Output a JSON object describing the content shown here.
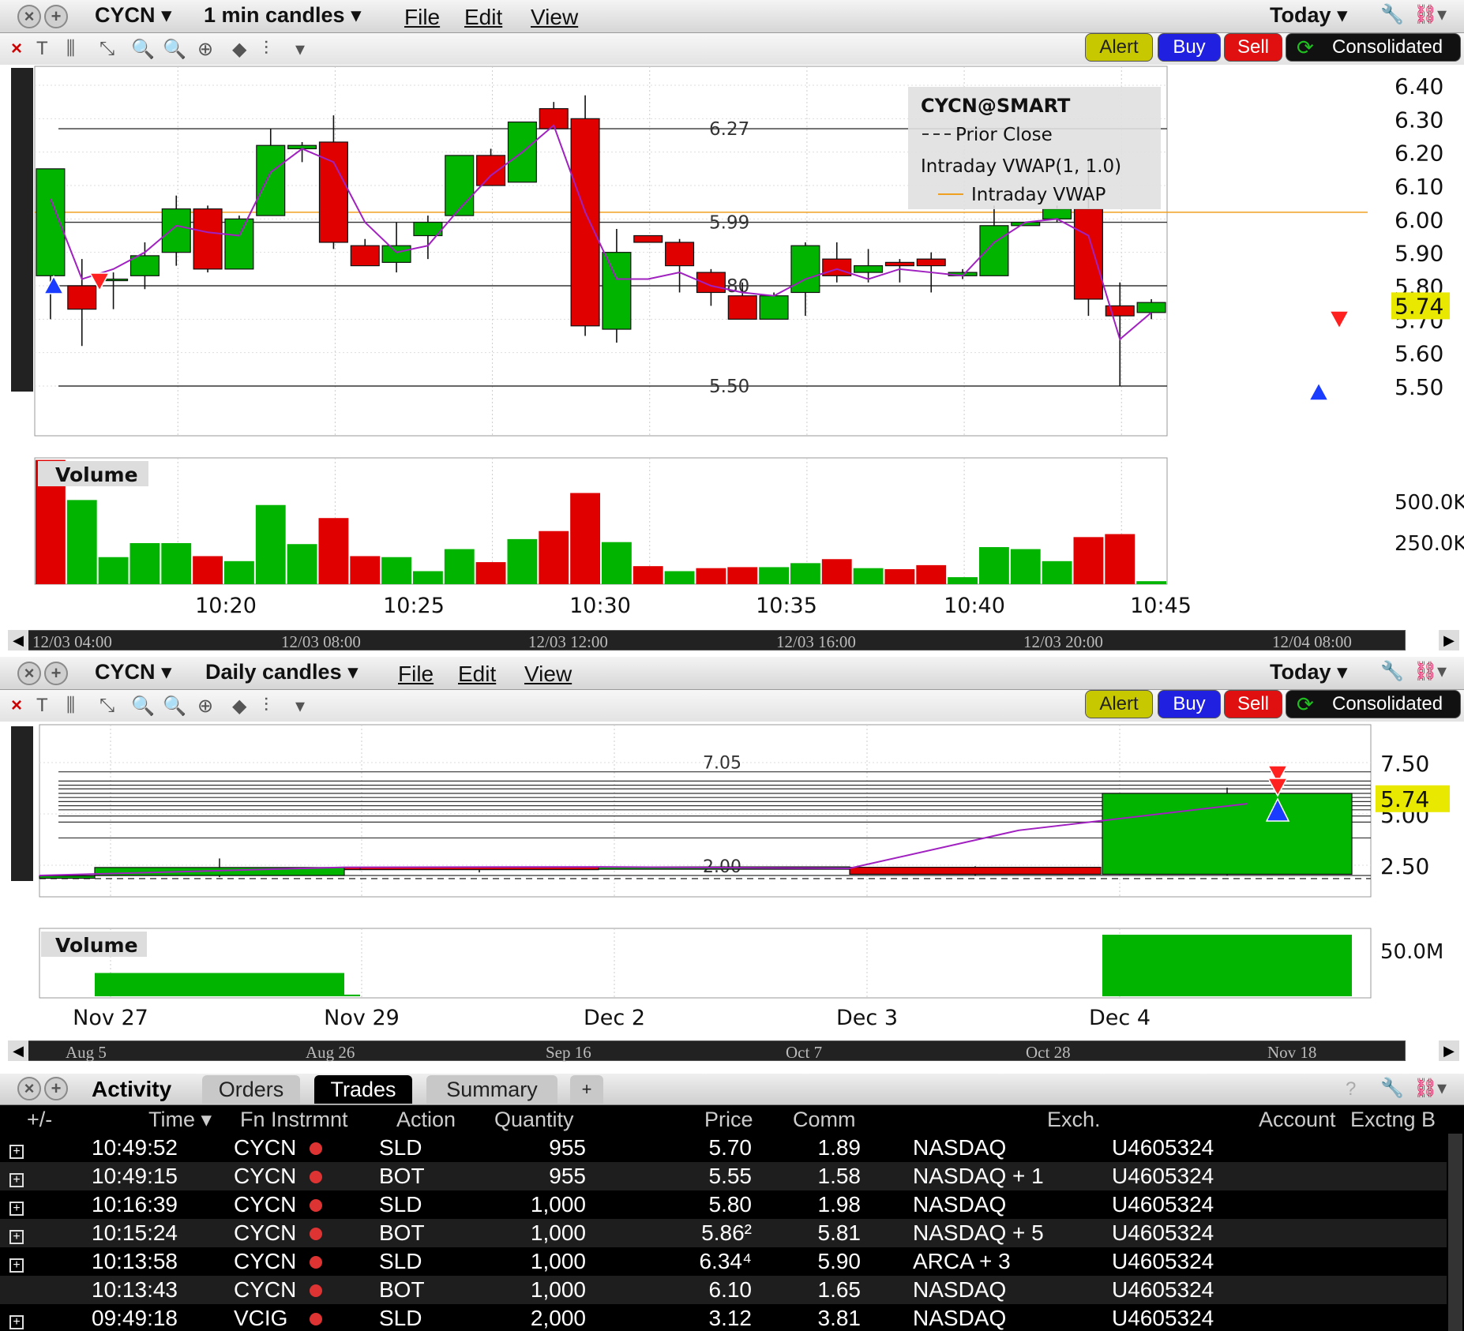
{
  "colors": {
    "up": "#00b400",
    "down": "#e00000",
    "vwap": "#a020c0",
    "prior_close": "#f0a020",
    "alert": "#c8c800",
    "buy": "#2020e0",
    "sell": "#e01010",
    "last_price_tag": "#e8e800"
  },
  "chart1": {
    "symbol": "CYCN",
    "timeframe": "1 min candles",
    "menu": [
      "File",
      "Edit",
      "View"
    ],
    "range": "Today",
    "buttons": {
      "alert": "Alert",
      "buy": "Buy",
      "sell": "Sell",
      "consolidated": "Consolidated"
    },
    "legend": {
      "title": "CYCN@SMART",
      "prior_close": "Prior Close",
      "vwap_study": "Intraday VWAP(1, 1.0)",
      "vwap": "Intraday VWAP"
    },
    "price_labels": [
      "6.27",
      "5.99",
      "5.80",
      "5.50"
    ],
    "last_price": "5.74",
    "volume_label": "Volume",
    "volume_ticks": [
      "500.0K",
      "250.0K"
    ],
    "x_ticks": [
      "10:20",
      "10:25",
      "10:30",
      "10:35",
      "10:40",
      "10:45"
    ],
    "nav_ticks": [
      "12/03 04:00",
      "12/03 08:00",
      "12/03 12:00",
      "12/03 16:00",
      "12/03 20:00",
      "12/04 08:00"
    ]
  },
  "chart2": {
    "symbol": "CYCN",
    "timeframe": "Daily candles",
    "menu": [
      "File",
      "Edit",
      "View"
    ],
    "range": "Today",
    "buttons": {
      "alert": "Alert",
      "buy": "Buy",
      "sell": "Sell",
      "consolidated": "Consolidated"
    },
    "price_labels": [
      "7.05",
      "2.00"
    ],
    "last_price": "5.74",
    "volume_label": "Volume",
    "volume_ticks": [
      "50.0M"
    ],
    "x_ticks": [
      "Nov 27",
      "Nov 29",
      "Dec 2",
      "Dec 3",
      "Dec 4"
    ],
    "nav_ticks": [
      "Aug 5",
      "Aug 26",
      "Sep 16",
      "Oct 7",
      "Oct 28",
      "Nov 18"
    ]
  },
  "chart_data": [
    {
      "type": "candlestick",
      "title": "CYCN 1 min candles",
      "ylim": [
        5.45,
        6.42
      ],
      "y_ticks": [
        "6.40",
        "6.30",
        "6.20",
        "6.10",
        "6.00",
        "5.90",
        "5.80",
        "5.70",
        "5.60",
        "5.50"
      ],
      "x_ticks": [
        "10:20",
        "10:25",
        "10:30",
        "10:35",
        "10:40",
        "10:45"
      ],
      "candles": [
        {
          "o": 5.83,
          "h": 6.15,
          "l": 5.7,
          "c": 6.15
        },
        {
          "o": 5.8,
          "h": 5.88,
          "l": 5.62,
          "c": 5.73
        },
        {
          "o": 5.82,
          "h": 5.84,
          "l": 5.73,
          "c": 5.82
        },
        {
          "o": 5.83,
          "h": 5.93,
          "l": 5.79,
          "c": 5.89
        },
        {
          "o": 5.9,
          "h": 6.07,
          "l": 5.86,
          "c": 6.03
        },
        {
          "o": 6.03,
          "h": 6.04,
          "l": 5.84,
          "c": 5.85
        },
        {
          "o": 5.85,
          "h": 6.01,
          "l": 5.85,
          "c": 6.0
        },
        {
          "o": 6.01,
          "h": 6.27,
          "l": 6.01,
          "c": 6.22
        },
        {
          "o": 6.21,
          "h": 6.23,
          "l": 6.17,
          "c": 6.22
        },
        {
          "o": 6.23,
          "h": 6.31,
          "l": 5.91,
          "c": 5.93
        },
        {
          "o": 5.92,
          "h": 5.94,
          "l": 5.86,
          "c": 5.86
        },
        {
          "o": 5.87,
          "h": 5.99,
          "l": 5.84,
          "c": 5.92
        },
        {
          "o": 5.95,
          "h": 6.01,
          "l": 5.88,
          "c": 5.99
        },
        {
          "o": 6.01,
          "h": 6.19,
          "l": 6.01,
          "c": 6.19
        },
        {
          "o": 6.19,
          "h": 6.21,
          "l": 6.1,
          "c": 6.1
        },
        {
          "o": 6.11,
          "h": 6.29,
          "l": 6.11,
          "c": 6.29
        },
        {
          "o": 6.33,
          "h": 6.35,
          "l": 6.28,
          "c": 6.27
        },
        {
          "o": 6.3,
          "h": 6.37,
          "l": 5.65,
          "c": 5.68
        },
        {
          "o": 5.67,
          "h": 5.97,
          "l": 5.63,
          "c": 5.9
        },
        {
          "o": 5.95,
          "h": 5.95,
          "l": 5.93,
          "c": 5.93
        },
        {
          "o": 5.93,
          "h": 5.94,
          "l": 5.78,
          "c": 5.86
        },
        {
          "o": 5.84,
          "h": 5.85,
          "l": 5.74,
          "c": 5.78
        },
        {
          "o": 5.77,
          "h": 5.81,
          "l": 5.7,
          "c": 5.7
        },
        {
          "o": 5.7,
          "h": 5.78,
          "l": 5.7,
          "c": 5.77
        },
        {
          "o": 5.78,
          "h": 5.93,
          "l": 5.71,
          "c": 5.92
        },
        {
          "o": 5.88,
          "h": 5.93,
          "l": 5.81,
          "c": 5.83
        },
        {
          "o": 5.84,
          "h": 5.91,
          "l": 5.81,
          "c": 5.86
        },
        {
          "o": 5.87,
          "h": 5.88,
          "l": 5.81,
          "c": 5.86
        },
        {
          "o": 5.88,
          "h": 5.9,
          "l": 5.78,
          "c": 5.86
        },
        {
          "o": 5.83,
          "h": 5.85,
          "l": 5.82,
          "c": 5.84
        },
        {
          "o": 5.83,
          "h": 6.04,
          "l": 5.83,
          "c": 5.98
        },
        {
          "o": 5.98,
          "h": 5.99,
          "l": 5.98,
          "c": 5.99
        },
        {
          "o": 6.0,
          "h": 6.04,
          "l": 5.99,
          "c": 6.03
        },
        {
          "o": 6.03,
          "h": 6.18,
          "l": 5.71,
          "c": 5.76
        },
        {
          "o": 5.74,
          "h": 5.81,
          "l": 5.5,
          "c": 5.71
        },
        {
          "o": 5.72,
          "h": 5.76,
          "l": 5.7,
          "c": 5.75
        }
      ],
      "vwap": [
        6.06,
        5.82,
        5.85,
        5.9,
        5.98,
        5.96,
        5.95,
        6.14,
        6.21,
        6.17,
        5.99,
        5.9,
        5.92,
        6.03,
        6.13,
        6.2,
        6.28,
        6.02,
        5.82,
        5.82,
        5.84,
        5.8,
        5.78,
        5.77,
        5.82,
        5.85,
        5.82,
        5.85,
        5.84,
        5.83,
        5.93,
        5.99,
        6.0,
        5.95,
        5.64,
        5.72
      ],
      "volume": [
        {
          "v": 620,
          "up": false
        },
        {
          "v": 420,
          "up": true
        },
        {
          "v": 135,
          "up": true
        },
        {
          "v": 205,
          "up": true
        },
        {
          "v": 205,
          "up": true
        },
        {
          "v": 140,
          "up": false
        },
        {
          "v": 115,
          "up": true
        },
        {
          "v": 395,
          "up": true
        },
        {
          "v": 200,
          "up": true
        },
        {
          "v": 330,
          "up": false
        },
        {
          "v": 140,
          "up": false
        },
        {
          "v": 135,
          "up": true
        },
        {
          "v": 65,
          "up": true
        },
        {
          "v": 175,
          "up": true
        },
        {
          "v": 110,
          "up": false
        },
        {
          "v": 225,
          "up": true
        },
        {
          "v": 265,
          "up": false
        },
        {
          "v": 455,
          "up": false
        },
        {
          "v": 210,
          "up": true
        },
        {
          "v": 90,
          "up": false
        },
        {
          "v": 65,
          "up": true
        },
        {
          "v": 80,
          "up": false
        },
        {
          "v": 85,
          "up": false
        },
        {
          "v": 85,
          "up": true
        },
        {
          "v": 105,
          "up": true
        },
        {
          "v": 125,
          "up": false
        },
        {
          "v": 80,
          "up": true
        },
        {
          "v": 75,
          "up": false
        },
        {
          "v": 95,
          "up": false
        },
        {
          "v": 35,
          "up": true
        },
        {
          "v": 185,
          "up": true
        },
        {
          "v": 175,
          "up": true
        },
        {
          "v": 115,
          "up": true
        },
        {
          "v": 235,
          "up": false
        },
        {
          "v": 250,
          "up": false
        },
        {
          "v": 15,
          "up": true
        }
      ]
    },
    {
      "type": "candlestick",
      "title": "CYCN Daily candles",
      "ylim": [
        1.5,
        8.5
      ],
      "y_ticks": [
        "7.50",
        "5.00",
        "2.50"
      ],
      "x_ticks": [
        "Nov 27",
        "Nov 29",
        "Dec 2",
        "Dec 3",
        "Dec 4"
      ],
      "candles": [
        {
          "o": 1.94,
          "h": 2.0,
          "l": 1.92,
          "c": 1.98
        },
        {
          "o": 2.0,
          "h": 2.83,
          "l": 1.92,
          "c": 2.39
        },
        {
          "o": 2.4,
          "h": 2.42,
          "l": 2.3,
          "c": 2.39
        },
        {
          "o": 2.4,
          "h": 2.43,
          "l": 2.15,
          "c": 2.35
        },
        {
          "o": 2.35,
          "h": 2.45,
          "l": 2.3,
          "c": 2.42
        },
        {
          "o": 2.4,
          "h": 2.45,
          "l": 1.98,
          "c": 2.06
        },
        {
          "o": 2.06,
          "h": 6.28,
          "l": 2.02,
          "c": 6.0
        }
      ],
      "volume": [
        {
          "v": 0,
          "up": true
        },
        {
          "v": 14,
          "up": true
        },
        {
          "v": 1,
          "up": true
        },
        {
          "v": 0,
          "up": true
        },
        {
          "v": 0,
          "up": true
        },
        {
          "v": 0,
          "up": false
        },
        {
          "v": 37,
          "up": true
        }
      ]
    }
  ],
  "activity": {
    "title": "Activity",
    "tabs": [
      "Orders",
      "Trades",
      "Summary",
      "+"
    ],
    "active_tab": "Trades",
    "columns": [
      "+/-",
      "Time",
      "Fn Instrmnt",
      "Action",
      "Quantity",
      "Price",
      "Comm",
      "Exch.",
      "Account",
      "Exctng B"
    ],
    "rows": [
      {
        "time": "10:49:52",
        "sym": "CYCN",
        "action": "SLD",
        "qty": "955",
        "price": "5.70",
        "comm": "1.89",
        "exch": "NASDAQ",
        "acct": "U4605324",
        "expand": true
      },
      {
        "time": "10:49:15",
        "sym": "CYCN",
        "action": "BOT",
        "qty": "955",
        "price": "5.55",
        "comm": "1.58",
        "exch": "NASDAQ + 1",
        "acct": "U4605324",
        "expand": true
      },
      {
        "time": "10:16:39",
        "sym": "CYCN",
        "action": "SLD",
        "qty": "1,000",
        "price": "5.80",
        "comm": "1.98",
        "exch": "NASDAQ",
        "acct": "U4605324",
        "expand": true
      },
      {
        "time": "10:15:24",
        "sym": "CYCN",
        "action": "BOT",
        "qty": "1,000",
        "price": "5.86²",
        "comm": "5.81",
        "exch": "NASDAQ + 5",
        "acct": "U4605324",
        "expand": true
      },
      {
        "time": "10:13:58",
        "sym": "CYCN",
        "action": "SLD",
        "qty": "1,000",
        "price": "6.34⁴",
        "comm": "5.90",
        "exch": "ARCA + 3",
        "acct": "U4605324",
        "expand": true
      },
      {
        "time": "10:13:43",
        "sym": "CYCN",
        "action": "BOT",
        "qty": "1,000",
        "price": "6.10",
        "comm": "1.65",
        "exch": "NASDAQ",
        "acct": "U4605324",
        "expand": false
      },
      {
        "time": "09:49:18",
        "sym": "VCIG",
        "action": "SLD",
        "qty": "2,000",
        "price": "3.12",
        "comm": "3.81",
        "exch": "NASDAQ",
        "acct": "U4605324",
        "expand": true
      }
    ]
  }
}
